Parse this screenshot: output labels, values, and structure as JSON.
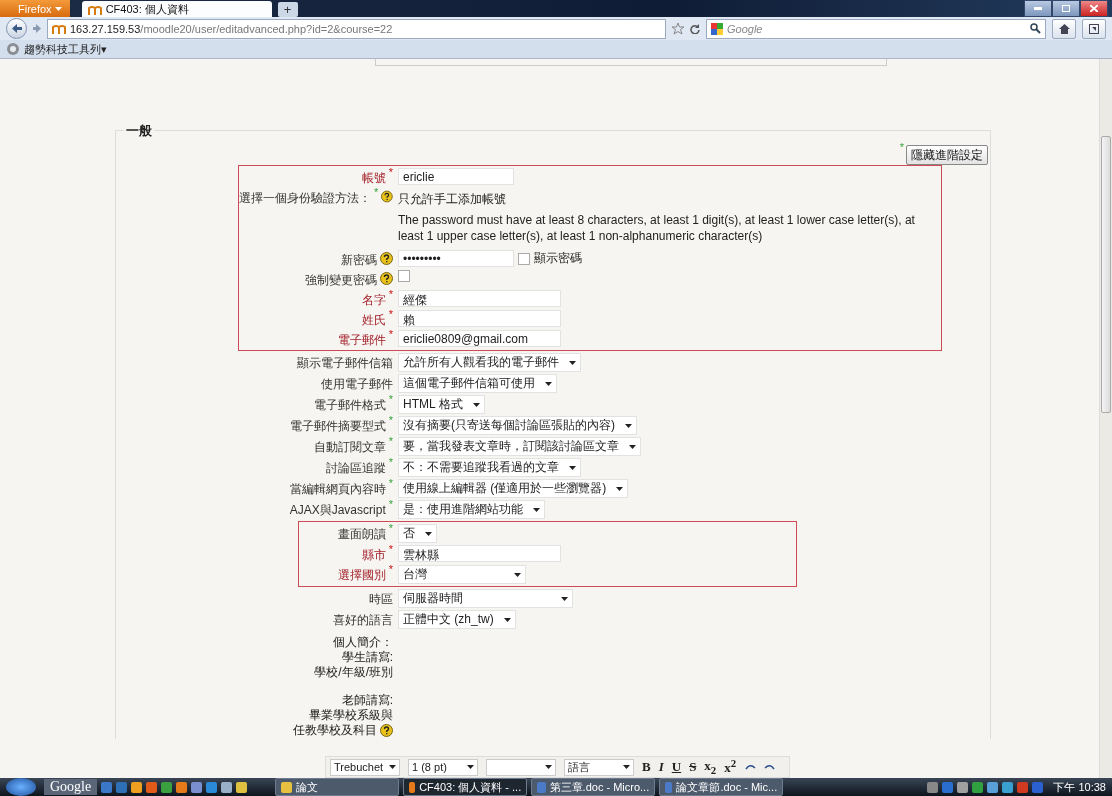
{
  "browser": {
    "menu_button": "Firefox",
    "tab": {
      "title": "CF403: 個人資料",
      "selected": true
    },
    "new_tab": "+",
    "url_host": "163.27.159.53",
    "url_path": "/moodle20/user/editadvanced.php?id=2&course=22",
    "search_placeholder": "Google",
    "bookmark": "趨勢科技工具列▾"
  },
  "form": {
    "legend": "一般",
    "advanced_marker": "*",
    "advanced_button": "隱藏進階設定",
    "groups": [
      {
        "highlighted": true,
        "rows": [
          {
            "kind": "text",
            "label": "帳號",
            "marker": {
              "text": "*",
              "kind": "required"
            },
            "value": "ericlie"
          },
          {
            "kind": "static",
            "label": "選擇一個身份驗證方法：",
            "marker": {
              "text": "*",
              "kind": "advanced"
            },
            "help": true,
            "value": "只允許手工添加帳號"
          },
          {
            "kind": "note",
            "value": "The password must have at least 8 characters, at least 1 digit(s), at least 1 lower case letter(s), at least 1 upper case letter(s), at least 1 non-alphanumeric character(s)"
          },
          {
            "kind": "password",
            "label": "新密碼",
            "help": true,
            "value": "•••••••••",
            "reveal": {
              "label": "顯示密碼",
              "checked": false
            }
          },
          {
            "kind": "checkbox",
            "label": "強制變更密碼",
            "help": true,
            "checked": false
          },
          {
            "kind": "text",
            "label": "名字",
            "marker": {
              "text": "*",
              "kind": "required"
            },
            "value": "經傑",
            "wide": true
          },
          {
            "kind": "text",
            "label": "姓氏",
            "marker": {
              "text": "*",
              "kind": "required"
            },
            "value": "賴",
            "wide": true
          },
          {
            "kind": "text",
            "label": "電子郵件",
            "marker": {
              "text": "*",
              "kind": "required"
            },
            "value": "ericlie0809@gmail.com",
            "wide": true
          }
        ]
      },
      {
        "highlighted": false,
        "rows": [
          {
            "kind": "select",
            "label": "顯示電子郵件信箱",
            "value": "允許所有人觀看我的電子郵件"
          },
          {
            "kind": "select",
            "label": "使用電子郵件",
            "value": "這個電子郵件信箱可使用"
          },
          {
            "kind": "select",
            "label": "電子郵件格式",
            "marker": {
              "text": "*",
              "kind": "advanced"
            },
            "value": "HTML 格式"
          },
          {
            "kind": "select",
            "label": "電子郵件摘要型式",
            "marker": {
              "text": "*",
              "kind": "advanced"
            },
            "value": "沒有摘要(只寄送每個討論區張貼的內容)"
          },
          {
            "kind": "select",
            "label": "自動訂閱文章",
            "marker": {
              "text": "*",
              "kind": "advanced"
            },
            "value": "要，當我發表文章時，訂閱該討論區文章"
          },
          {
            "kind": "select",
            "label": "討論區追蹤",
            "marker": {
              "text": "*",
              "kind": "advanced"
            },
            "value": "不：不需要追蹤我看過的文章"
          },
          {
            "kind": "select",
            "label": "當編輯網頁內容時",
            "marker": {
              "text": "*",
              "kind": "advanced"
            },
            "value": "使用線上編輯器 (僅適用於一些瀏覽器)"
          },
          {
            "kind": "select",
            "label": "AJAX與Javascript",
            "marker": {
              "text": "*",
              "kind": "advanced"
            },
            "value": "是：使用進階網站功能"
          }
        ]
      },
      {
        "highlighted": true,
        "rows": [
          {
            "kind": "select",
            "label": "畫面朗讀",
            "marker": {
              "text": "*",
              "kind": "advanced"
            },
            "value": "否"
          },
          {
            "kind": "text",
            "label": "縣市",
            "marker": {
              "text": "*",
              "kind": "required"
            },
            "value": "雲林縣",
            "wide": true
          },
          {
            "kind": "select",
            "label": "選擇國別",
            "marker": {
              "text": "*",
              "kind": "required"
            },
            "value": "台灣",
            "wide": true
          }
        ]
      },
      {
        "highlighted": false,
        "rows": [
          {
            "kind": "select",
            "label": "時區",
            "value": "伺服器時間",
            "wide": true
          },
          {
            "kind": "select",
            "label": "喜好的語言",
            "value": "正體中文 (zh_tw)"
          },
          {
            "kind": "multiline",
            "label_blocks": [
              [
                "個人簡介：",
                "學生請寫:",
                "學校/年級/班別"
              ],
              [
                "老師請寫:",
                "畢業學校系級與",
                "任教學校及科目"
              ]
            ],
            "help": true
          }
        ]
      }
    ]
  },
  "editor_toolbar": {
    "selects": [
      {
        "kind": "labeled",
        "text": "Trebuchet"
      },
      {
        "kind": "labeled",
        "text": "1 (8 pt)"
      },
      {
        "kind": "blank"
      },
      {
        "kind": "labeled",
        "text": "語言"
      }
    ],
    "format_buttons": [
      "B",
      "I",
      "U",
      "S"
    ],
    "script_buttons": [
      "x$_{2}$",
      "x$^{2}$"
    ]
  },
  "taskbar": {
    "google": "Google",
    "tasks": [
      {
        "label": "論文",
        "selected": false
      },
      {
        "label": "CF403: 個人資料 - ...",
        "selected": true
      },
      {
        "label": "第三章.doc - Micro...",
        "selected": false
      },
      {
        "label": "論文章節.doc - Mic...",
        "selected": false
      }
    ],
    "clock": "下午 10:38"
  }
}
